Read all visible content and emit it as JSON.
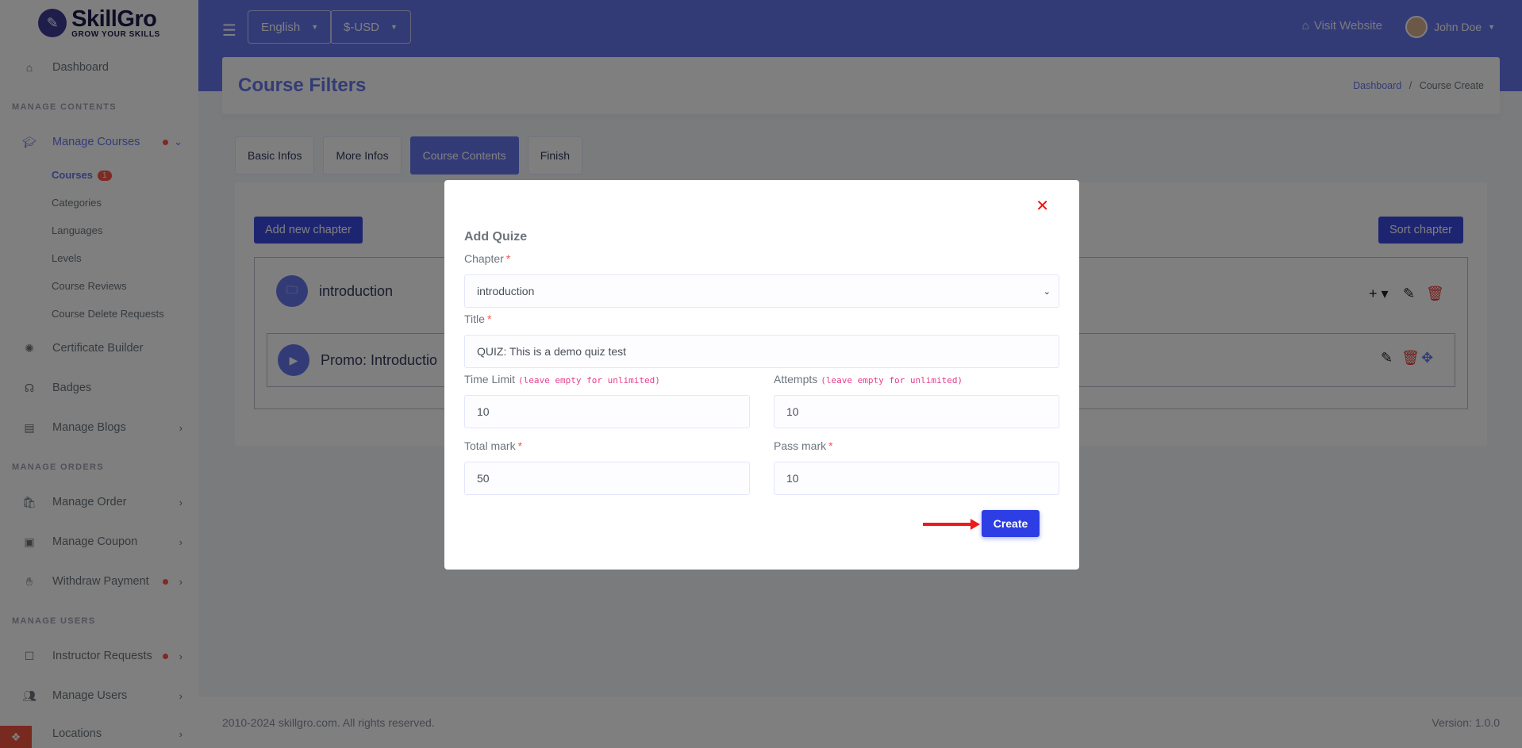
{
  "brand": {
    "name": "SkillGro",
    "tagline": "GROW YOUR SKILLS"
  },
  "sidebar": {
    "dashboard": "Dashboard",
    "section_contents": "MANAGE CONTENTS",
    "manage_courses": "Manage Courses",
    "courses": "Courses",
    "courses_badge": "1",
    "categories": "Categories",
    "languages": "Languages",
    "levels": "Levels",
    "course_reviews": "Course Reviews",
    "course_delete_requests": "Course Delete Requests",
    "certificate_builder": "Certificate Builder",
    "badges": "Badges",
    "manage_blogs": "Manage Blogs",
    "section_orders": "MANAGE ORDERS",
    "manage_order": "Manage Order",
    "manage_coupon": "Manage Coupon",
    "withdraw_payment": "Withdraw Payment",
    "section_users": "MANAGE USERS",
    "instructor_requests": "Instructor Requests",
    "manage_users": "Manage Users",
    "locations": "Locations"
  },
  "topbar": {
    "language": "English",
    "currency": "$-USD",
    "visit_website": "Visit Website",
    "user_name": "John Doe"
  },
  "page": {
    "title": "Course Filters",
    "breadcrumb_home": "Dashboard",
    "breadcrumb_sep": "/",
    "breadcrumb_current": "Course Create"
  },
  "tabs": [
    "Basic Infos",
    "More Infos",
    "Course Contents",
    "Finish"
  ],
  "content": {
    "add_chapter": "Add new chapter",
    "sort_chapter": "Sort chapter",
    "chapter_title": "introduction",
    "lesson_title": "Promo: Introductio"
  },
  "modal": {
    "title": "Add Quize",
    "chapter_label": "Chapter",
    "chapter_value": "introduction",
    "title_label": "Title",
    "title_value": "QUIZ: This is a demo quiz test",
    "time_limit_label": "Time Limit",
    "time_limit_hint": "(leave empty for unlimited)",
    "time_limit_value": "10",
    "attempts_label": "Attempts",
    "attempts_hint": "(leave empty for unlimited)",
    "attempts_value": "10",
    "total_mark_label": "Total mark",
    "total_mark_value": "50",
    "pass_mark_label": "Pass mark",
    "pass_mark_value": "10",
    "required_mark": "*",
    "create_button": "Create"
  },
  "footer": {
    "copyright": "2010-2024 skillgro.com. All rights reserved.",
    "version": "Version: 1.0.0"
  },
  "colors": {
    "primary": "#6777ef",
    "button": "#2d3ee4",
    "danger": "#fc544b"
  }
}
